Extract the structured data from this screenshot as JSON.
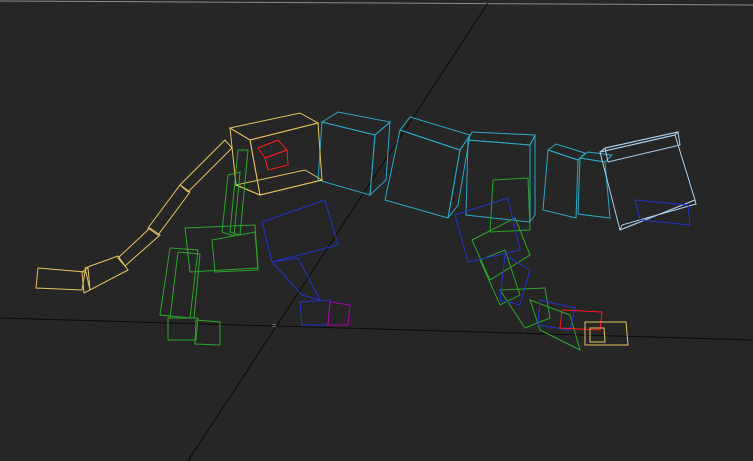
{
  "viewport": {
    "background": "#262626",
    "colors": {
      "head_spine_front": "#e6c35a",
      "spine": "#29a7c4",
      "pelvis": "#a9cfee",
      "right_limbs": "#2aa52a",
      "left_limbs": "#2233cc",
      "selected": "#ff1a1a",
      "hand_left": "#b000b0"
    }
  }
}
